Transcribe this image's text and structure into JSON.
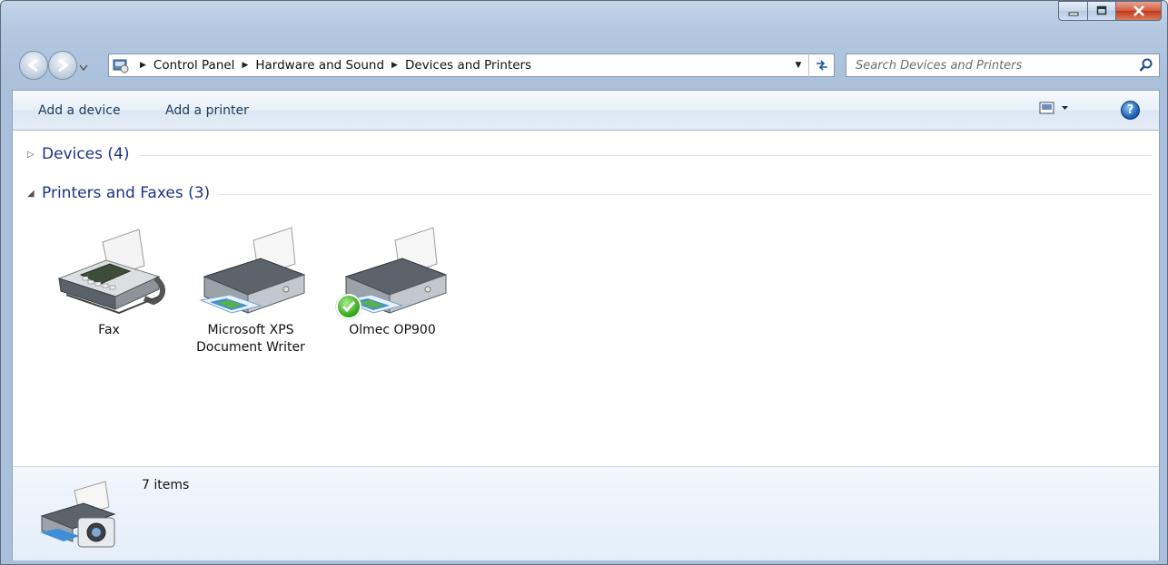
{
  "window": {
    "controls": {
      "minimize": "minimize",
      "maximize": "maximize",
      "close": "close"
    }
  },
  "navigation": {
    "breadcrumbs": [
      "Control Panel",
      "Hardware and Sound",
      "Devices and Printers"
    ],
    "search_placeholder": "Search Devices and Printers"
  },
  "toolbar": {
    "add_device_label": "Add a device",
    "add_printer_label": "Add a printer"
  },
  "groups": {
    "devices": {
      "title": "Devices (4)",
      "expanded": false
    },
    "printers": {
      "title": "Printers and Faxes (3)",
      "expanded": true
    }
  },
  "printers": [
    {
      "label": "Fax",
      "icon": "fax-machine-icon",
      "default": false
    },
    {
      "label": "Microsoft XPS\nDocument Writer",
      "icon": "printer-icon",
      "default": false
    },
    {
      "label": "Olmec OP900",
      "icon": "printer-icon",
      "default": true
    }
  ],
  "details": {
    "item_count": "7 items"
  },
  "colors": {
    "group_title": "#1e3287",
    "accent": "#1b59a6",
    "default_check": "#35a81c"
  }
}
